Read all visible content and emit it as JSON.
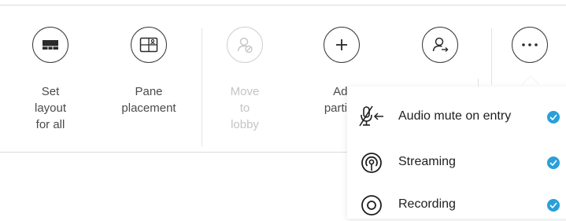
{
  "toolbar": {
    "buttons": [
      {
        "label_lines": [
          "Set",
          "layout",
          "for all"
        ],
        "icon": "layout-icon",
        "enabled": true
      },
      {
        "label_lines": [
          "Pane",
          "placement"
        ],
        "icon": "pane-placement-icon",
        "enabled": true
      },
      {
        "label_lines": [
          "Move",
          "to",
          "lobby"
        ],
        "icon": "move-to-lobby-icon",
        "enabled": false
      },
      {
        "label_lines": [
          "Adc",
          "particip"
        ],
        "icon": "plus-icon",
        "enabled": true
      },
      {
        "icon": "transfer-participant-icon",
        "enabled": true
      },
      {
        "icon": "more-options-icon",
        "enabled": true
      }
    ]
  },
  "menu": {
    "items": [
      {
        "label": "Audio mute on entry",
        "icon": "mic-muted-icon",
        "checked": true
      },
      {
        "label": "Streaming",
        "icon": "streaming-icon",
        "checked": true
      },
      {
        "label": "Recording",
        "icon": "recording-icon",
        "checked": true
      }
    ],
    "check_color": "#2a9fd8"
  }
}
